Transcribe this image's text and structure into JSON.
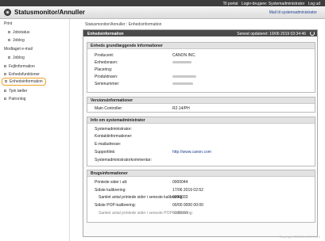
{
  "topbar": {
    "portal": "Til portal",
    "login": "Login-brugere: Systemadministrator",
    "logout": "Log ud"
  },
  "header": {
    "title": "Statusmonitor/Annuller",
    "admin_link": "Mail til systemadministrator"
  },
  "sidebar": {
    "print": "Print",
    "jobstatus": "Jobstatus",
    "joblog": "Joblog",
    "received": "Modtaget e-mail",
    "received_joblog": "Joblog",
    "errors": "Fejlinformation",
    "unit_functions": "Enhedsfunktioner",
    "device_info": "Enhedsinformation",
    "check_counters": "Tjek tæller",
    "eco_info": "Patronlog"
  },
  "breadcrumb": "Statusmonitor/Annuller : Enhedsinformation",
  "panel": {
    "title": "Enhedsinformation",
    "updated": "Senest opdateret: 19/06 2019 03:34:46"
  },
  "basic": {
    "title": "Enheds grundlæggende informationer",
    "manufacturer_label": "Producent:",
    "manufacturer_value": "CANON INC.",
    "device_name_label": "Enhedsnavn:",
    "location_label": "Placering:",
    "product_name_label": "Produktnavn:",
    "serial_label": "Serienummer:"
  },
  "version": {
    "title": "Versionsinformationer",
    "controller_label": "Main Controller:",
    "controller_value": "R2.14/PH"
  },
  "sysadmin": {
    "title": "Info om systemadministrator",
    "admin_label": "Systemadministrator:",
    "contact_label": "Kontaktinformationer:",
    "email_label": "E-mailadresse:",
    "support_label": "Supportlink:",
    "support_value": "http://www.canon.com",
    "comment_label": "Systemadministratorkommentar:"
  },
  "usage": {
    "title": "Brugsinformationer",
    "pages_label": "Printede sider i alt:",
    "pages_value": "0000044",
    "calib_label": "Sidste kalibrering:",
    "calib_value": "17/06 2019 02:52",
    "calib_pages_label": "Samlet antal printede sider i seneste kalibrering:",
    "calib_pages_value": "0000033",
    "pop_label": "Sidste POP-kalibrering:",
    "pop_value": "00/00 0000 00:00",
    "pop_pages_label": "Samlet antal printede sider i seneste POP-kalibrering:",
    "pop_pages_value": "0000000"
  },
  "footer": "Copyright CANON INC. 2019"
}
